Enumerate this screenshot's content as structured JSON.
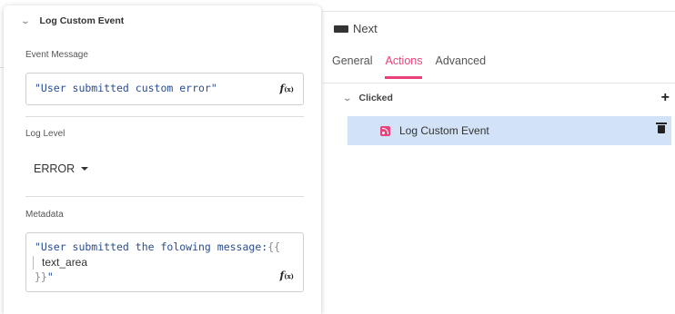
{
  "inspector": {
    "button_name": "Next",
    "tabs": [
      {
        "label": "General",
        "active": false
      },
      {
        "label": "Actions",
        "active": true
      },
      {
        "label": "Advanced",
        "active": false
      }
    ],
    "event_group": "Clicked",
    "action_item": "Log Custom Event"
  },
  "panel": {
    "title": "Log Custom Event",
    "event_message": {
      "label": "Event Message",
      "value": "\"User submitted custom error\"",
      "fx_label": "f",
      "fx_sub": "(x)"
    },
    "log_level": {
      "label": "Log Level",
      "value": "ERROR"
    },
    "metadata": {
      "label": "Metadata",
      "line1_string": "\"User submitted the folowing message:",
      "line1_brace": "{{",
      "line2_var": "text_area",
      "line3_brace": "}}",
      "line3_quote": "\"",
      "fx_label": "f",
      "fx_sub": "(x)"
    }
  },
  "colors": {
    "accent": "#e8417c",
    "selected_row": "#d2e2f7",
    "code_string": "#2a4d8f"
  }
}
